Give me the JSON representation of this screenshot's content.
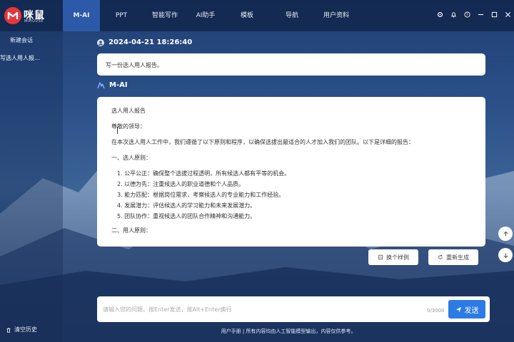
{
  "brand": {
    "name": "咪鼠",
    "sub": "MIHOUSE",
    "color": "#e8343b"
  },
  "nav": {
    "items": [
      "M-AI",
      "PPT",
      "智能写作",
      "AI助手",
      "模板",
      "导航",
      "用户资料"
    ],
    "active_index": 0
  },
  "window_icons": [
    "settings-icon",
    "bell-icon",
    "help-icon",
    "minimize-icon",
    "maximize-icon",
    "close-icon"
  ],
  "sidebar": {
    "new_chat": "新建会话",
    "history": [
      "写选人用人报..."
    ],
    "clear_history": "清空历史"
  },
  "chat": {
    "timestamp": "2024-04-21 18:26:40",
    "user_message": "写一份选人用人报告。",
    "ai_name": "M-AI",
    "ai_response": {
      "title": "选人用人报告",
      "greeting": "尊敬的领导：",
      "intro": "在本次选人用人工作中，我们遵循了以下原则和程序，以确保选拔出最适合的人才加入我们的团队。以下是详细的报告：",
      "section1_title": "一、选人原则：",
      "section1_items": [
        "1. 公平公正：确保整个选拔过程透明，所有候选人都有平等的机会。",
        "2. 以德为先：注重候选人的职业道德和个人品质。",
        "3. 能力匹配：根据岗位需求，考察候选人的专业能力和工作经验。",
        "4. 发展潜力：评估候选人的学习能力和未来发展潜力。",
        "5. 团队协作：重视候选人的团队合作精神和沟通能力。"
      ],
      "section2_title": "二、用人原则："
    },
    "actions": {
      "another": "换个样例",
      "regenerate": "重新生成"
    }
  },
  "input": {
    "placeholder": "请输入您的问题，按Enter发送，按Alt+Enter换行",
    "counter": "0/3000",
    "send_label": "发送"
  },
  "footer": "用户手册 | 所有内容均由人工智能模型输出，内容仅供参考。",
  "colors": {
    "accent": "#2c7be5",
    "topbar": "#10244a",
    "active_tab": "#2c5aa8"
  }
}
